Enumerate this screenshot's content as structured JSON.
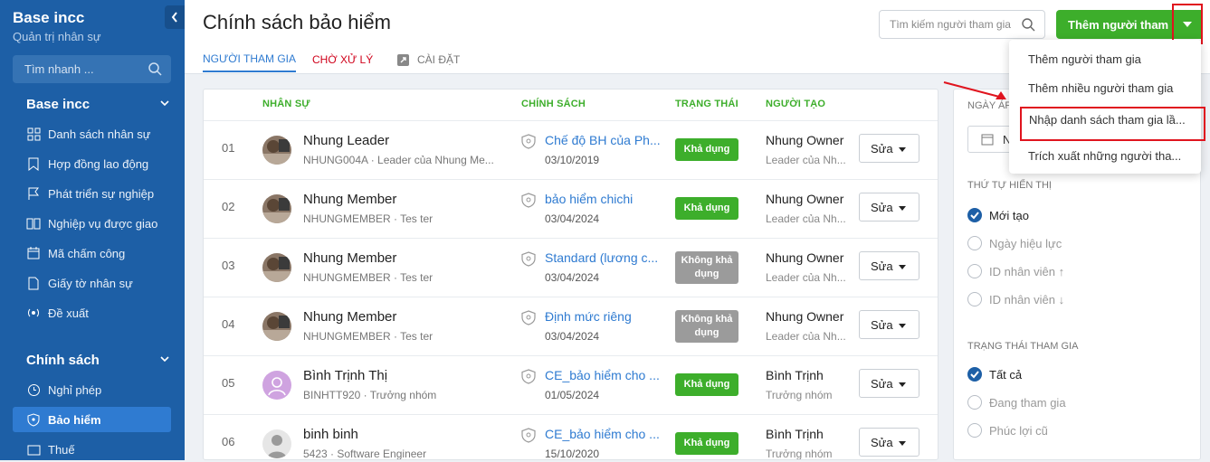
{
  "sidebar": {
    "app_title": "Base incc",
    "app_subtitle": "Quản trị nhân sự",
    "search_placeholder": "Tìm nhanh ...",
    "section1": "Base incc",
    "items1": [
      "Danh sách nhân sự",
      "Hợp đồng lao động",
      "Phát triển sự nghiệp",
      "Nghiệp vụ được giao",
      "Mã chấm công",
      "Giấy tờ nhân sự",
      "Đề xuất"
    ],
    "section2": "Chính sách",
    "items2": [
      "Nghỉ phép",
      "Bảo hiểm",
      "Thuế"
    ]
  },
  "header": {
    "title": "Chính sách bảo hiểm",
    "tabs": [
      "NGƯỜI THAM GIA",
      "CHỜ XỬ LÝ",
      "CÀI ĐẶT"
    ],
    "search_placeholder": "Tìm kiếm người tham gia",
    "add_button": "Thêm người tham gia"
  },
  "dropdown": {
    "items": [
      "Thêm người tham gia",
      "Thêm nhiều người tham gia",
      "Nhập danh sách tham gia lầ...",
      "Trích xuất những người tha..."
    ]
  },
  "table": {
    "columns": [
      "NHÂN SỰ",
      "CHÍNH SÁCH",
      "TRẠNG THÁI",
      "NGƯỜI TẠO"
    ],
    "edit_label": "Sửa",
    "rows": [
      {
        "idx": "01",
        "name": "Nhung Leader",
        "sub": "NHUNG004A · Leader của Nhung Me...",
        "policy": "Chế độ BH của Ph...",
        "date": "03/10/2019",
        "status": "Khả dụng",
        "status_type": "on",
        "creator": "Nhung Owner",
        "role": "Leader của Nh..."
      },
      {
        "idx": "02",
        "name": "Nhung Member",
        "sub": "NHUNGMEMBER · Tes ter",
        "policy": "bảo hiểm chichi",
        "date": "03/04/2024",
        "status": "Khả dụng",
        "status_type": "on",
        "creator": "Nhung Owner",
        "role": "Leader của Nh..."
      },
      {
        "idx": "03",
        "name": "Nhung Member",
        "sub": "NHUNGMEMBER · Tes ter",
        "policy": "Standard (lương c...",
        "date": "03/04/2024",
        "status": "Không khả dụng",
        "status_type": "off",
        "creator": "Nhung Owner",
        "role": "Leader của Nh..."
      },
      {
        "idx": "04",
        "name": "Nhung Member",
        "sub": "NHUNGMEMBER · Tes ter",
        "policy": "Định mức riêng",
        "date": "03/04/2024",
        "status": "Không khả dụng",
        "status_type": "off",
        "creator": "Nhung Owner",
        "role": "Leader của Nh..."
      },
      {
        "idx": "05",
        "name": "Bình Trịnh Thị",
        "sub": "BINHTT920 · Trưởng nhóm",
        "policy": "CE_bảo hiểm cho ...",
        "date": "01/05/2024",
        "status": "Khả dụng",
        "status_type": "on",
        "creator": "Bình Trịnh",
        "role": "Trưởng nhóm"
      },
      {
        "idx": "06",
        "name": "binh binh",
        "sub": "5423 · Software Engineer",
        "policy": "CE_bảo hiểm cho ...",
        "date": "15/10/2020",
        "status": "Khả dụng",
        "status_type": "on",
        "creator": "Bình Trịnh",
        "role": "Trưởng nhóm"
      }
    ]
  },
  "filters": {
    "date_label": "NGÀY ÁP",
    "date_value": "N",
    "order_label": "THỨ TỰ HIỂN THỊ",
    "order_options": [
      "Mới tạo",
      "Ngày hiệu lực",
      "ID nhân viên ↑",
      "ID nhân viên ↓"
    ],
    "status_label": "TRẠNG THÁI THAM GIA",
    "status_options": [
      "Tất cả",
      "Đang tham gia",
      "Phúc lợi cũ"
    ]
  },
  "colors": {
    "sidebar": "#1d5fa6",
    "accent": "#2f7bd1",
    "green": "#3dae2b",
    "highlight": "#e0141e"
  }
}
